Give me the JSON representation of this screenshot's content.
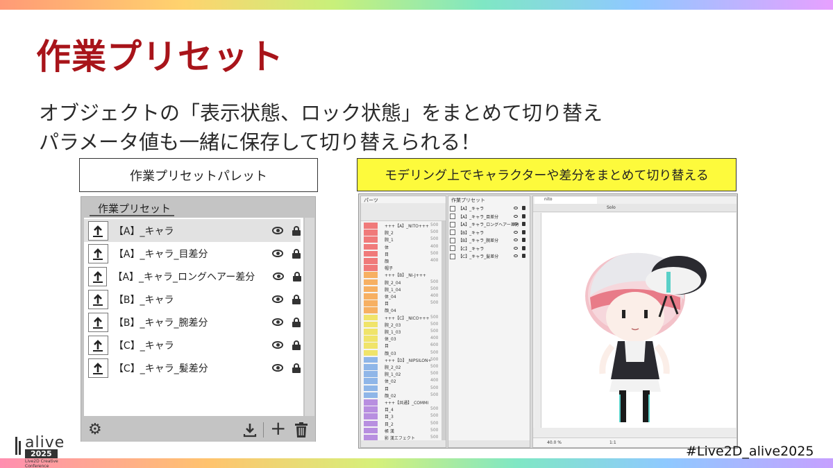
{
  "slide": {
    "title": "作業プリセット",
    "subtitle_line1": "オブジェクトの「表示状態、ロック状態」をまとめて切り替え",
    "subtitle_line2": "パラメータ値も一緒に保存して切り替えられる！",
    "caption_left": "作業プリセットパレット",
    "caption_right": "モデリング上でキャラクターや差分をまとめて切り替える",
    "hashtag": "#Live2D_alive2025",
    "accent_color": "#a8141a",
    "highlight_color": "#fdfa3c"
  },
  "palette": {
    "tab_label": "作業プリセット",
    "presets": [
      {
        "label": "【A】_キャラ",
        "selected": true
      },
      {
        "label": "【A】_キャラ_目差分",
        "selected": false
      },
      {
        "label": "【A】_キャラ_ロングヘアー差分",
        "selected": false
      },
      {
        "label": "【B】_キャラ",
        "selected": false
      },
      {
        "label": "【B】_キャラ_腕差分",
        "selected": false
      },
      {
        "label": "【C】_キャラ",
        "selected": false
      },
      {
        "label": "【C】_キャラ_髪差分",
        "selected": false
      }
    ],
    "footer_icons": [
      "gear-icon",
      "download-icon",
      "plus-icon",
      "trash-icon"
    ]
  },
  "editor": {
    "parts_tab": "パーツ",
    "presets_tab": "作業プリセット",
    "canvas_tab": "nito",
    "solo_label": "Solo",
    "zoom": "40.0 %",
    "ratio": "1:1",
    "parts": [
      {
        "name": "+++【A】_NITO+++",
        "num": "500",
        "color": "#f07a7a"
      },
      {
        "name": "腕_2",
        "num": "500",
        "color": "#f07a7a"
      },
      {
        "name": "腕_1",
        "num": "500",
        "color": "#f07a7a"
      },
      {
        "name": "体",
        "num": "400",
        "color": "#f07a7a"
      },
      {
        "name": "目",
        "num": "500",
        "color": "#f07a7a"
      },
      {
        "name": "顔",
        "num": "400",
        "color": "#f07a7a"
      },
      {
        "name": "帽子",
        "num": "",
        "color": "#f07a7a"
      },
      {
        "name": "+++【B】_NI-J+++",
        "num": "",
        "color": "#f7b062"
      },
      {
        "name": "腕_2_04",
        "num": "500",
        "color": "#f7b062"
      },
      {
        "name": "腕_1_04",
        "num": "500",
        "color": "#f7b062"
      },
      {
        "name": "体_04",
        "num": "400",
        "color": "#f7b062"
      },
      {
        "name": "目",
        "num": "500",
        "color": "#f7b062"
      },
      {
        "name": "顔_04",
        "num": "",
        "color": "#f7b062"
      },
      {
        "name": "+++【C】_NICO+++",
        "num": "500",
        "color": "#f0e46a"
      },
      {
        "name": "腕_2_03",
        "num": "500",
        "color": "#f0e46a"
      },
      {
        "name": "腕_1_03",
        "num": "500",
        "color": "#f0e46a"
      },
      {
        "name": "体_03",
        "num": "400",
        "color": "#f0e46a"
      },
      {
        "name": "目",
        "num": "600",
        "color": "#f0e46a"
      },
      {
        "name": "顔_03",
        "num": "500",
        "color": "#f0e46a"
      },
      {
        "name": "+++【D】_NIPSILON+",
        "num": "500",
        "color": "#8fb6e8"
      },
      {
        "name": "腕_2_02",
        "num": "500",
        "color": "#8fb6e8"
      },
      {
        "name": "腕_1_02",
        "num": "500",
        "color": "#8fb6e8"
      },
      {
        "name": "体_02",
        "num": "400",
        "color": "#8fb6e8"
      },
      {
        "name": "目",
        "num": "500",
        "color": "#8fb6e8"
      },
      {
        "name": "顔_02",
        "num": "500",
        "color": "#8fb6e8"
      },
      {
        "name": "+++【共通】_COMMI",
        "num": "",
        "color": "#b88fe0"
      },
      {
        "name": "目_4",
        "num": "500",
        "color": "#b88fe0"
      },
      {
        "name": "目_3",
        "num": "500",
        "color": "#b88fe0"
      },
      {
        "name": "目_2",
        "num": "500",
        "color": "#b88fe0"
      },
      {
        "name": "帳 漢",
        "num": "500",
        "color": "#b88fe0"
      },
      {
        "name": "影 漢エフェクト",
        "num": "500",
        "color": "#b88fe0"
      }
    ],
    "mini_presets": [
      {
        "label": "【A】_キャラ"
      },
      {
        "label": "【A】_キャラ_目差分"
      },
      {
        "label": "【A】_キャラ_ロングヘアー差分"
      },
      {
        "label": "【B】_キャラ"
      },
      {
        "label": "【B】_キャラ_腕差分"
      },
      {
        "label": "【C】_キャラ"
      },
      {
        "label": "【C】_キャラ_髪差分"
      }
    ]
  },
  "logo": {
    "brand": "alive",
    "year": "2025",
    "tagline": "Live2D Creative Conference"
  }
}
